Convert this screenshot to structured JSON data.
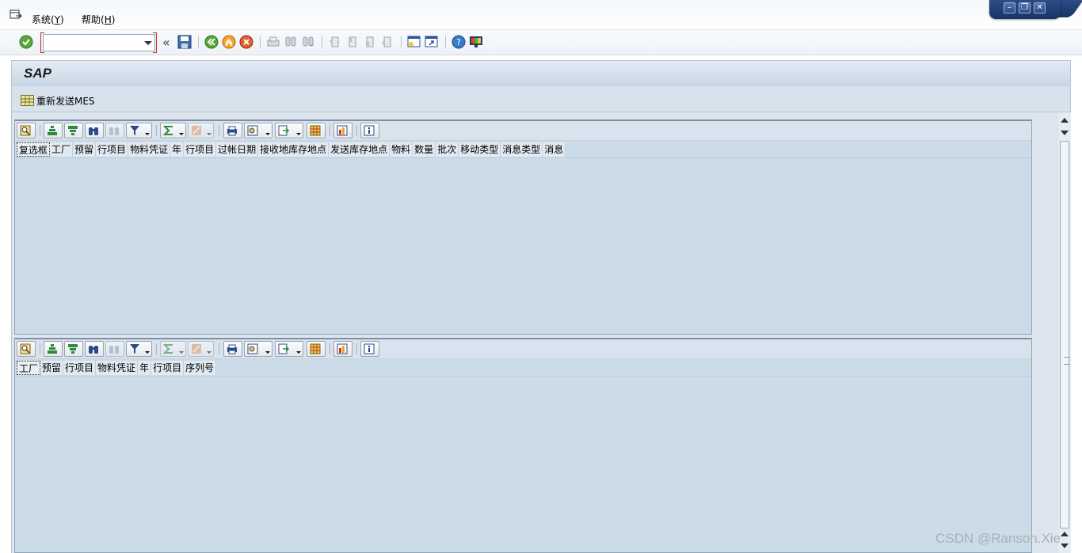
{
  "menu": {
    "items": [
      {
        "label": "系统(",
        "accel": "Y",
        "end": ")"
      },
      {
        "label": "帮助(",
        "accel": "H",
        "end": ")"
      }
    ]
  },
  "window_controls": {
    "minimize": "–",
    "restore": "❐",
    "close": "✕"
  },
  "toolbar": {
    "command_field_value": "",
    "chevron": "«"
  },
  "title": "SAP",
  "app_toolbar": {
    "resend_label": "重新发送MES"
  },
  "grid_top": {
    "columns": [
      "复选框",
      "工厂",
      "预留",
      "行项目",
      "物料凭证",
      "年",
      "行项目",
      "过帐日期",
      "接收地库存地点",
      "发送库存地点",
      "物料",
      "数量",
      "批次",
      "移动类型",
      "消息类型",
      "消息"
    ]
  },
  "grid_bottom": {
    "columns": [
      "工厂",
      "预留",
      "行项目",
      "物料凭证",
      "年",
      "行项目",
      "序列号"
    ]
  },
  "splitter": "......",
  "watermark": "CSDN @Ranson.Xie",
  "colors": {
    "accent_blue": "#1f3e78",
    "grid_bg": "#ccdbe8",
    "title_bg": "#c9d7e6"
  }
}
